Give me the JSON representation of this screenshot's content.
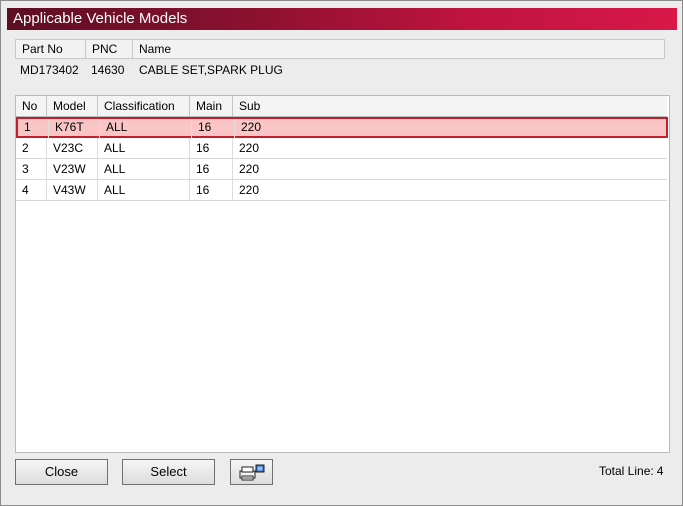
{
  "window": {
    "title": "Applicable Vehicle Models"
  },
  "part": {
    "headers": {
      "part_no": "Part No",
      "pnc": "PNC",
      "name": "Name"
    },
    "values": {
      "part_no": "MD173402",
      "pnc": "14630",
      "name": "CABLE SET,SPARK PLUG"
    }
  },
  "grid": {
    "columns": {
      "no": "No",
      "model": "Model",
      "classification": "Classification",
      "main": "Main",
      "sub": "Sub"
    },
    "rows": [
      {
        "no": "1",
        "model": "K76T",
        "classification": "ALL",
        "main": "16",
        "sub": "220",
        "selected": true
      },
      {
        "no": "2",
        "model": "V23C",
        "classification": "ALL",
        "main": "16",
        "sub": "220"
      },
      {
        "no": "3",
        "model": "V23W",
        "classification": "ALL",
        "main": "16",
        "sub": "220"
      },
      {
        "no": "4",
        "model": "V43W",
        "classification": "ALL",
        "main": "16",
        "sub": "220"
      }
    ],
    "selection_color": "#c41e2a"
  },
  "footer": {
    "close_label": "Close",
    "select_label": "Select",
    "print_icon": "printer-icon",
    "total_label": "Total Line:",
    "total_value": "4"
  },
  "colors": {
    "title_start": "#5c0e22",
    "title_end": "#d81848"
  }
}
